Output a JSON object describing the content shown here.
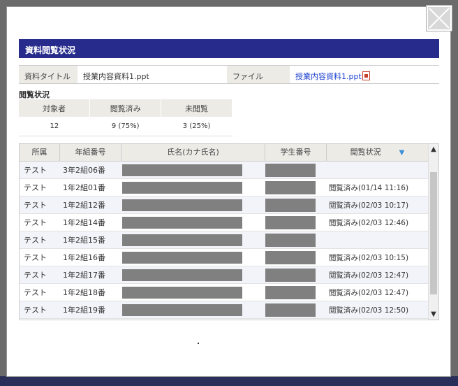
{
  "modal": {
    "header_title": "資料閲覧状況",
    "close_icon": "close-icon"
  },
  "info": {
    "title_label": "資料タイトル",
    "title_value": "授業内容資料1.ppt",
    "file_label": "ファイル",
    "file_link": "授業内容資料1.ppt",
    "file_icon": "pdf-icon"
  },
  "stats": {
    "section_title": "閲覧状況",
    "headers": [
      "対象者",
      "閲覧済み",
      "未閲覧"
    ],
    "values": [
      "12",
      "9 (75%)",
      "3 (25%)"
    ]
  },
  "list": {
    "headers": [
      "所属",
      "年組番号",
      "氏名(カナ氏名)",
      "学生番号",
      "閲覧状況"
    ],
    "sort_icon": "sort-down-icon",
    "rows": [
      {
        "affil": "テスト",
        "number": "3年2組06番",
        "status": ""
      },
      {
        "affil": "テスト",
        "number": "1年2組01番",
        "status": "閲覧済み(01/14 11:16)"
      },
      {
        "affil": "テスト",
        "number": "1年2組12番",
        "status": "閲覧済み(02/03 10:17)"
      },
      {
        "affil": "テスト",
        "number": "1年2組14番",
        "status": "閲覧済み(02/03 12:46)"
      },
      {
        "affil": "テスト",
        "number": "1年2組15番",
        "status": ""
      },
      {
        "affil": "テスト",
        "number": "1年2組16番",
        "status": "閲覧済み(02/03 10:15)"
      },
      {
        "affil": "テスト",
        "number": "1年2組17番",
        "status": "閲覧済み(02/03 12:47)"
      },
      {
        "affil": "テスト",
        "number": "1年2組18番",
        "status": "閲覧済み(02/03 12:47)"
      },
      {
        "affil": "テスト",
        "number": "1年2組19番",
        "status": "閲覧済み(02/03 12:50)"
      }
    ]
  },
  "colors": {
    "header_bg": "#262b8c",
    "link": "#1a3fcf"
  }
}
